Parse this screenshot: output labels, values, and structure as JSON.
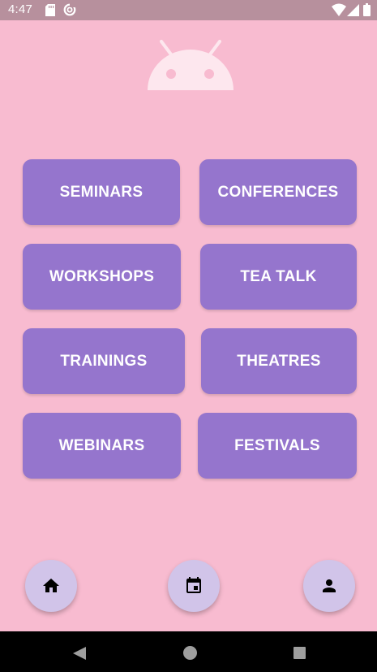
{
  "status_bar": {
    "time": "4:47",
    "icons": [
      "sd-card-icon",
      "data-saver-icon",
      "wifi-icon",
      "signal-icon",
      "battery-icon"
    ]
  },
  "logo": {
    "icon": "android-icon"
  },
  "categories": [
    {
      "label": "SEMINARS"
    },
    {
      "label": "CONFERENCES"
    },
    {
      "label": "WORKSHOPS"
    },
    {
      "label": "TEA TALK"
    },
    {
      "label": "TRAININGS"
    },
    {
      "label": "THEATRES"
    },
    {
      "label": "WEBINARS"
    },
    {
      "label": "FESTIVALS"
    }
  ],
  "bottom_actions": [
    {
      "icon": "home-icon"
    },
    {
      "icon": "calendar-event-icon"
    },
    {
      "icon": "person-icon"
    }
  ],
  "nav_bar": {
    "icons": [
      "back-icon",
      "home-circle-icon",
      "recents-icon"
    ]
  },
  "colors": {
    "background": "#f8bbd0",
    "status_bar": "#b7909d",
    "button": "#9575cd",
    "fab": "#d1c4e9",
    "nav_bar": "#000000"
  }
}
